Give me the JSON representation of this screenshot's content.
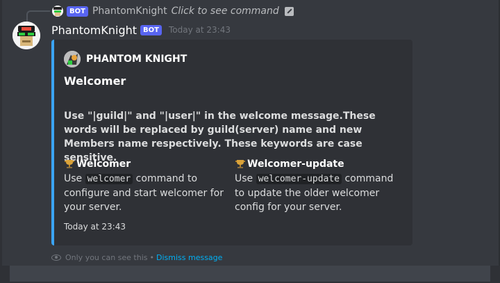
{
  "reply": {
    "bot_tag": "BOT",
    "username": "PhantomKnight",
    "command_hint": "Click to see command"
  },
  "message": {
    "username": "PhantomKnight",
    "bot_tag": "BOT",
    "timestamp": "Today at 23:43"
  },
  "embed": {
    "accent_color": "#3ba4f5",
    "author": "PHANTOM KNIGHT",
    "title": "Welcomer",
    "description": "Use \"|guild|\" and \"|user|\" in the welcome message.These words will be replaced by guild(server) name and new Members name respectively. These keywords are case sensitive.",
    "fields": [
      {
        "name": "Welcomer",
        "value_prefix": "Use ",
        "code": "welcomer",
        "value_suffix": " command to configure and start welcomer for your server.",
        "icon": "trophy-icon"
      },
      {
        "name": "Welcomer-update",
        "value_prefix": "Use ",
        "code": "welcomer-update",
        "value_suffix": " command to update the older welcomer config for your server.",
        "icon": "trophy-icon"
      }
    ],
    "footer": "Today at 23:43"
  },
  "ephemeral": {
    "notice": "Only you can see this",
    "separator": "•",
    "dismiss": "Dismiss message"
  },
  "colors": {
    "background": "#36393f",
    "embed_bg": "#2f3136",
    "bot_tag": "#5865f2",
    "link": "#00aff4"
  }
}
